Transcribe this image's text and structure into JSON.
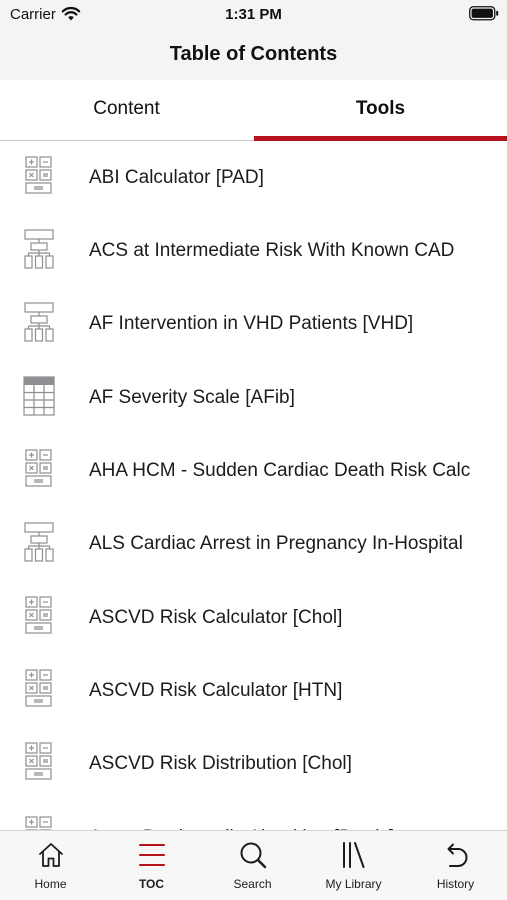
{
  "status_bar": {
    "carrier": "Carrier",
    "time": "1:31 PM"
  },
  "nav": {
    "title": "Table of Contents"
  },
  "tabs": [
    {
      "label": "Content",
      "selected": false
    },
    {
      "label": "Tools",
      "selected": true
    }
  ],
  "accent_color": "#b5121b",
  "items": [
    {
      "label": "ABI Calculator [PAD]",
      "icon": "calculator-icon"
    },
    {
      "label": "ACS at Intermediate Risk With Known CAD",
      "icon": "algorithm-icon"
    },
    {
      "label": "AF Intervention in VHD Patients [VHD]",
      "icon": "algorithm-icon"
    },
    {
      "label": "AF Severity Scale [AFib]",
      "icon": "table-icon"
    },
    {
      "label": "AHA HCM - Sudden Cardiac Death Risk Calc",
      "icon": "calculator-icon"
    },
    {
      "label": "ALS Cardiac Arrest in Pregnancy In-Hospital",
      "icon": "algorithm-icon"
    },
    {
      "label": "ASCVD Risk Calculator [Chol]",
      "icon": "calculator-icon"
    },
    {
      "label": "ASCVD Risk Calculator [HTN]",
      "icon": "calculator-icon"
    },
    {
      "label": "ASCVD Risk Distribution [Chol]",
      "icon": "calculator-icon"
    },
    {
      "label": "Acute Bradycardia Algorithm [Brady]",
      "icon": "calculator-icon"
    }
  ],
  "tab_bar": [
    {
      "label": "Home",
      "icon": "home-icon",
      "active": false
    },
    {
      "label": "TOC",
      "icon": "toc-icon",
      "active": true
    },
    {
      "label": "Search",
      "icon": "search-icon",
      "active": false
    },
    {
      "label": "My Library",
      "icon": "library-icon",
      "active": false
    },
    {
      "label": "History",
      "icon": "history-icon",
      "active": false
    }
  ]
}
